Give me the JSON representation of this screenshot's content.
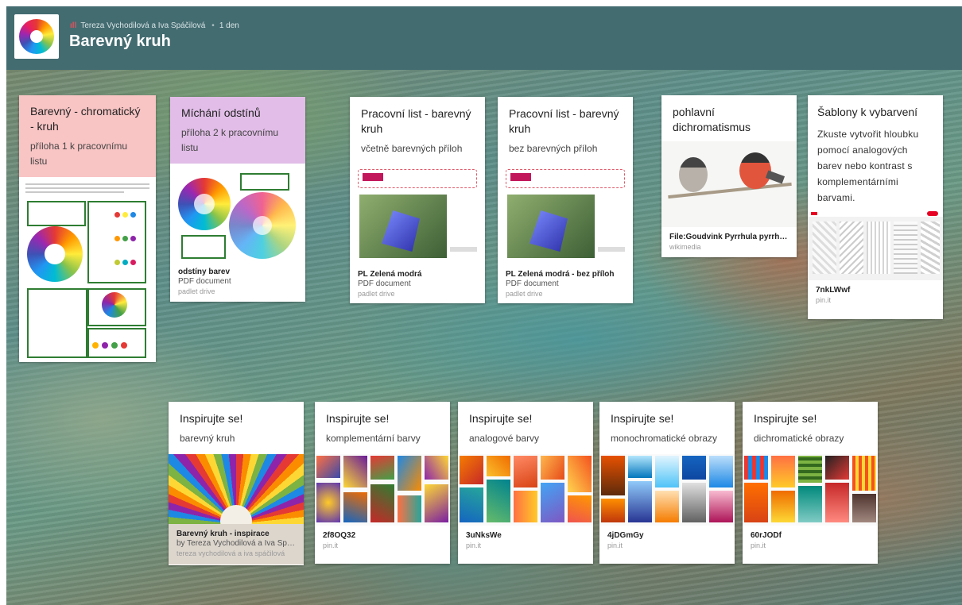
{
  "header": {
    "author": "Tereza Vychodilová a Iva Spáčilová",
    "time": "1 den",
    "title": "Barevný kruh"
  },
  "cards": {
    "c1": {
      "title": "Barevný - chromatický - kruh",
      "sub": "příloha 1 k pracovnímu listu"
    },
    "c2": {
      "title": "Míchání odstínů",
      "sub": "příloha 2 k pracovnímu listu",
      "f_title": "odstíny barev",
      "f_sub": "PDF document",
      "f_src": "padlet drive"
    },
    "c3": {
      "title": "Pracovní list - barevný kruh",
      "sub": "včetně barevných příloh",
      "f_title": "PL Zelená modrá",
      "f_sub": "PDF document",
      "f_src": "padlet drive"
    },
    "c4": {
      "title": "Pracovní list - barevný kruh",
      "sub": "bez barevných příloh",
      "f_title": "PL Zelená modrá - bez příloh",
      "f_sub": "PDF document",
      "f_src": "padlet drive"
    },
    "c5": {
      "title": "pohlavní dichromatismus",
      "f_title": "File:Goudvink Pyrrhula pyrrhul…",
      "f_src": "wikimedia"
    },
    "c6": {
      "title": "Šablony k vybarvení",
      "body": "Zkuste vytvořit hloubku pomocí analogových barev nebo kontrast s komplementárními barvami.",
      "f_title": "7nkLWwf",
      "f_src": "pin.it"
    },
    "c7": {
      "title": "Inspirujte se!",
      "sub": "barevný kruh",
      "f_title": "Barevný kruh - inspirace",
      "f_sub": "by Tereza Vychodilová a Iva Sp…",
      "f_src": "tereza vychodilová a iva spáčilová"
    },
    "c8": {
      "title": "Inspirujte se!",
      "sub": "komplementární barvy",
      "f_title": "2f8OQ32",
      "f_src": "pin.it"
    },
    "c9": {
      "title": "Inspirujte se!",
      "sub": "analogové barvy",
      "f_title": "3uNksWe",
      "f_src": "pin.it"
    },
    "c10": {
      "title": "Inspirujte se!",
      "sub": "monochromatické obrazy",
      "f_title": "4jDGmGy",
      "f_src": "pin.it"
    },
    "c11": {
      "title": "Inspirujte se!",
      "sub": "dichromatické obrazy",
      "f_title": "60rJODf",
      "f_src": "pin.it"
    }
  },
  "colors": {
    "header_bg": "#436c71",
    "card_pink": "#f8c4c4",
    "card_lilac": "#e1bde7"
  },
  "icons": {
    "author": "bar-chart-icon",
    "logo": "color-wheel-logo"
  }
}
